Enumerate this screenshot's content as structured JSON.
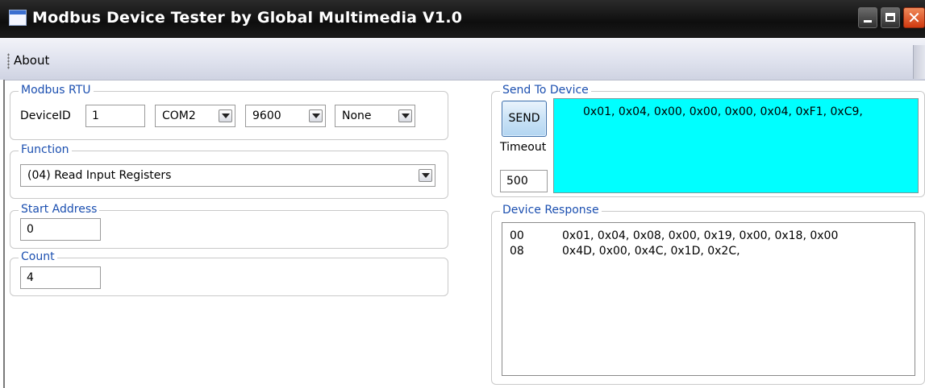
{
  "window": {
    "title": "Modbus Device Tester by Global Multimedia V1.0",
    "close_glyph": "✕"
  },
  "menu": {
    "items": [
      {
        "label": "About"
      }
    ]
  },
  "modbus_rtu": {
    "legend": "Modbus RTU",
    "device_id_label": "DeviceID",
    "device_id_value": "1",
    "port_value": "COM2",
    "baud_value": "9600",
    "parity_value": "None"
  },
  "function": {
    "legend": "Function",
    "selected": "(04) Read Input Registers"
  },
  "start_address": {
    "legend": "Start Address",
    "value": "0"
  },
  "count": {
    "legend": "Count",
    "value": "4"
  },
  "send_to_device": {
    "legend": "Send To Device",
    "send_label": "SEND",
    "timeout_label": "Timeout",
    "timeout_value": "500",
    "payload": "0x01, 0x04, 0x00, 0x00, 0x00, 0x04, 0xF1, 0xC9,",
    "payload_bg": "#00ffff"
  },
  "device_response": {
    "legend": "Device Response",
    "rows": [
      {
        "offset": "00",
        "bytes": "0x01, 0x04, 0x08, 0x00, 0x19, 0x00, 0x18, 0x00"
      },
      {
        "offset": "08",
        "bytes": "0x4D, 0x00, 0x4C, 0x1D, 0x2C,"
      }
    ]
  },
  "colors": {
    "legend_text": "#1b4fb0",
    "titlebar": "#111111",
    "close_button": "#d03a10"
  }
}
